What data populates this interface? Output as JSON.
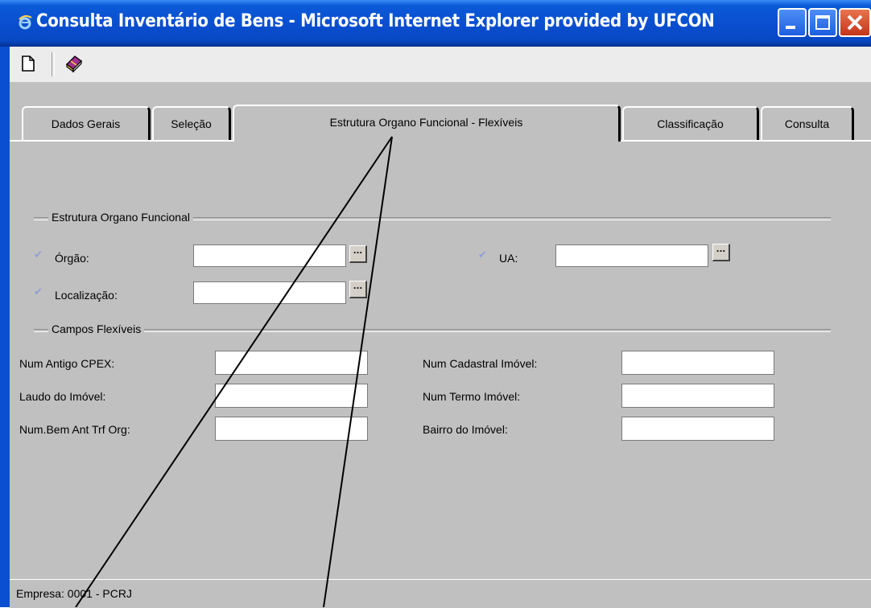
{
  "window": {
    "title": "Consulta Inventário de Bens - Microsoft Internet Explorer provided by UFCON"
  },
  "toolbar": {
    "icons": [
      "new-document-icon",
      "book-icon"
    ]
  },
  "tabs": [
    {
      "label": "Dados Gerais",
      "active": false
    },
    {
      "label": "Seleção",
      "active": false
    },
    {
      "label": "Estrutura Organo Funcional - Flexíveis",
      "active": true
    },
    {
      "label": "Classificação",
      "active": false
    },
    {
      "label": "Consulta",
      "active": false
    }
  ],
  "section_estrutura": {
    "title": "Estrutura Organo Funcional",
    "orgao_label": "Órgão:",
    "orgao_value": "",
    "ua_label": "UA:",
    "ua_value": "",
    "localizacao_label": "Localização:",
    "localizacao_value": "",
    "lookup_button": "..."
  },
  "section_flexiveis": {
    "title": "Campos Flexíveis",
    "fields": [
      {
        "label": "Num Antigo CPEX:",
        "value": ""
      },
      {
        "label": "Laudo do Imóvel:",
        "value": ""
      },
      {
        "label": "Num.Bem Ant Trf Org:",
        "value": ""
      },
      {
        "label": "Num Cadastral Imóvel:",
        "value": ""
      },
      {
        "label": "Num Termo Imóvel:",
        "value": ""
      },
      {
        "label": "Bairro do Imóvel:",
        "value": ""
      }
    ]
  },
  "status": {
    "text": "Empresa: 0001 - PCRJ"
  },
  "colors": {
    "titlebar": "#0a4fd0",
    "panel": "#c0c0c0",
    "check_mark": "#8f9fd6"
  }
}
